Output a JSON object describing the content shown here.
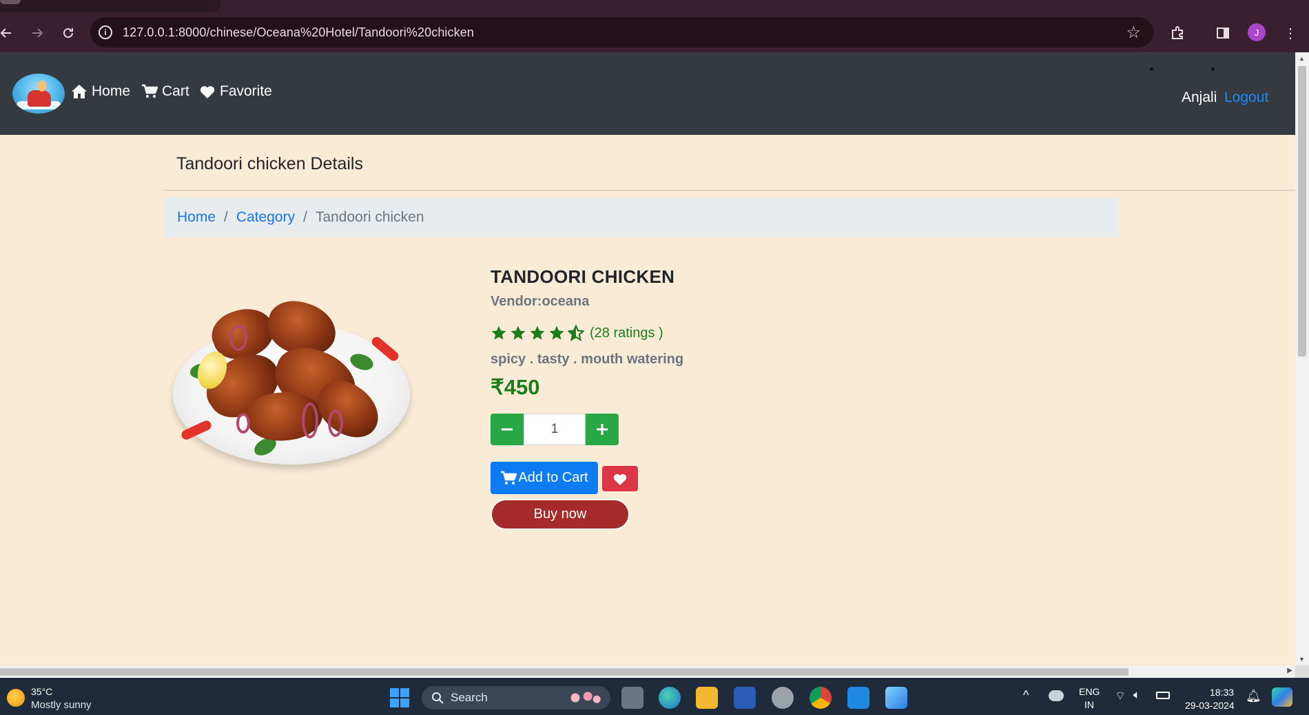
{
  "browser": {
    "url": "127.0.0.1:8000/chinese/Oceana%20Hotel/Tandoori%20chicken",
    "profile_initial": "J"
  },
  "navbar": {
    "home_label": "Home",
    "cart_label": "Cart",
    "favorite_label": "Favorite",
    "user_name": "Anjali",
    "logout_label": "Logout"
  },
  "page": {
    "title": "Tandoori chicken Details"
  },
  "breadcrumb": {
    "items": [
      "Home",
      "Category",
      "Tandoori chicken"
    ],
    "separator": "/"
  },
  "product": {
    "name": "TANDOORI CHICKEN",
    "vendor": "Vendor:oceana",
    "rating_stars": 4.5,
    "rating_count_text": "(28 ratings )",
    "tags": "spicy . tasty . mouth watering",
    "price": "₹450",
    "quantity": "1",
    "add_to_cart_label": "Add to Cart",
    "buy_now_label": "Buy now"
  },
  "colors": {
    "navbar_bg": "#343a40",
    "page_bg": "#faebd7",
    "rating_green": "#1b7d1b",
    "qty_green": "#28a745",
    "cart_blue": "#0d7cf2",
    "favorite_red": "#dc3545",
    "buy_now_brown": "#a52a2a",
    "link_blue": "#1a73e8"
  },
  "taskbar": {
    "weather_temp": "35°C",
    "weather_condition": "Mostly sunny",
    "search_placeholder": "Search",
    "language_top": "ENG",
    "language_bottom": "IN",
    "time": "18:33",
    "date": "29-03-2024"
  }
}
